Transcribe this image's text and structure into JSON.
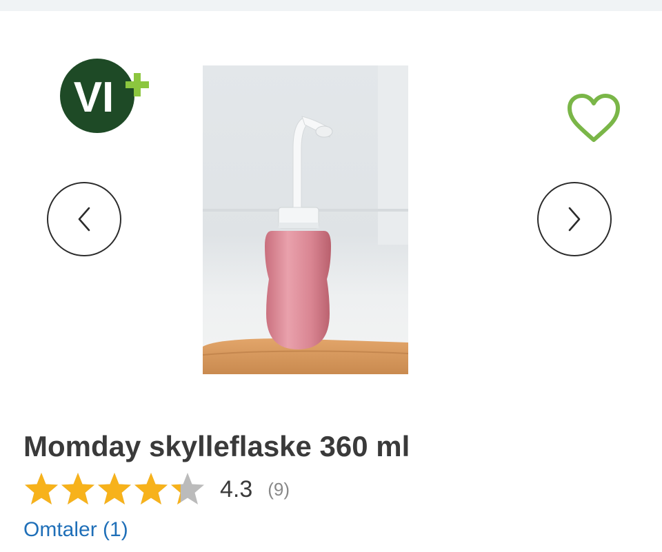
{
  "brand": {
    "logo_text": "VI",
    "logo_badge": "+",
    "logo_icon": "vi-plus-logo",
    "colors": {
      "dark_green": "#1e4a26",
      "accent_green": "#8cc63f"
    }
  },
  "gallery": {
    "prev_icon": "chevron-left-icon",
    "next_icon": "chevron-right-icon",
    "favorite_icon": "heart-outline-icon",
    "image_subject": "pink-rinse-bottle"
  },
  "product": {
    "title": "Momday skylleflaske 360 ml",
    "rating": {
      "value": "4.3",
      "count": "(9)",
      "stars_filled": 4.3,
      "stars_max": 5,
      "star_color": "#f7b21b",
      "star_empty_color": "#bbbbbb"
    },
    "reviews_link": "Omtaler (1)"
  }
}
